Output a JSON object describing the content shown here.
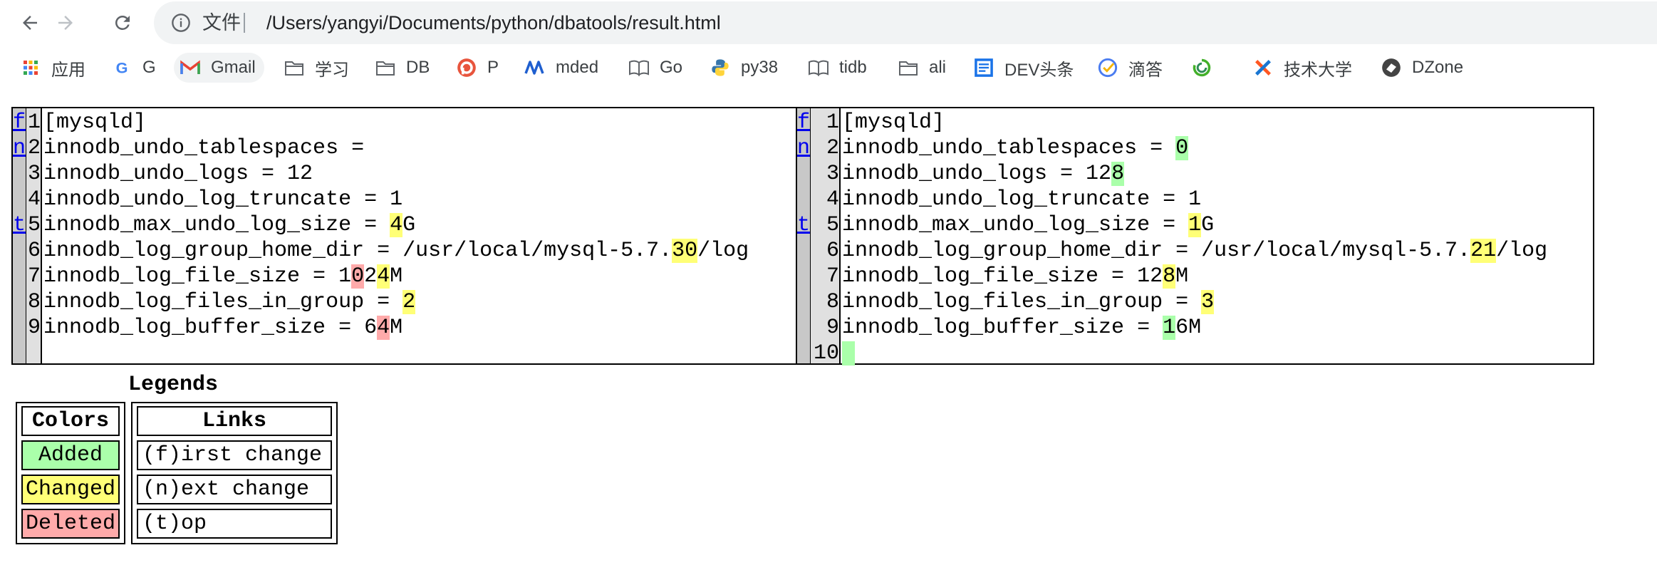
{
  "browser": {
    "info_label": "文件",
    "url": "/Users/yangyi/Documents/python/dbatools/result.html"
  },
  "bookmarks": {
    "apps": "应用",
    "google": "G",
    "gmail": "Gmail",
    "study": "学习",
    "db": "DB",
    "p": "P",
    "mded": "mded",
    "go": "Go",
    "py38": "py38",
    "tidb": "tidb",
    "ali": "ali",
    "dev": "DEV头条",
    "didiao": "滴答",
    "tech": "技术大学",
    "dzone": "DZone"
  },
  "diff": {
    "nav_links": {
      "first": "f",
      "next": "n",
      "top": "t"
    },
    "left": {
      "lines": [
        {
          "num": "1",
          "parts": [
            {
              "t": "[mysqld]",
              "s": ""
            }
          ]
        },
        {
          "num": "2",
          "parts": [
            {
              "t": "innodb_undo_tablespaces = ",
              "s": ""
            }
          ]
        },
        {
          "num": "3",
          "parts": [
            {
              "t": "innodb_undo_logs = 12",
              "s": ""
            }
          ]
        },
        {
          "num": "4",
          "parts": [
            {
              "t": "innodb_undo_log_truncate = 1",
              "s": ""
            }
          ]
        },
        {
          "num": "5",
          "parts": [
            {
              "t": "innodb_max_undo_log_size = ",
              "s": ""
            },
            {
              "t": "4",
              "s": "chg"
            },
            {
              "t": "G",
              "s": ""
            }
          ]
        },
        {
          "num": "6",
          "parts": [
            {
              "t": "innodb_log_group_home_dir = /usr/local/mysql-5.7.",
              "s": ""
            },
            {
              "t": "30",
              "s": "chg"
            },
            {
              "t": "/log",
              "s": ""
            }
          ]
        },
        {
          "num": "7",
          "parts": [
            {
              "t": "innodb_log_file_size = 1",
              "s": ""
            },
            {
              "t": "0",
              "s": "del"
            },
            {
              "t": "2",
              "s": ""
            },
            {
              "t": "4",
              "s": "chg"
            },
            {
              "t": "M",
              "s": ""
            }
          ]
        },
        {
          "num": "8",
          "parts": [
            {
              "t": "innodb_log_files_in_group = ",
              "s": ""
            },
            {
              "t": "2",
              "s": "chg"
            }
          ]
        },
        {
          "num": "9",
          "parts": [
            {
              "t": "innodb_log_buffer_size = 6",
              "s": ""
            },
            {
              "t": "4",
              "s": "del"
            },
            {
              "t": "M",
              "s": ""
            }
          ]
        }
      ]
    },
    "right": {
      "lines": [
        {
          "num": "1",
          "parts": [
            {
              "t": "[mysqld]",
              "s": ""
            }
          ]
        },
        {
          "num": "2",
          "parts": [
            {
              "t": "innodb_undo_tablespaces = ",
              "s": ""
            },
            {
              "t": "0",
              "s": "add"
            }
          ]
        },
        {
          "num": "3",
          "parts": [
            {
              "t": "innodb_undo_logs = 12",
              "s": ""
            },
            {
              "t": "8",
              "s": "add"
            }
          ]
        },
        {
          "num": "4",
          "parts": [
            {
              "t": "innodb_undo_log_truncate = 1",
              "s": ""
            }
          ]
        },
        {
          "num": "5",
          "parts": [
            {
              "t": "innodb_max_undo_log_size = ",
              "s": ""
            },
            {
              "t": "1",
              "s": "chg"
            },
            {
              "t": "G",
              "s": ""
            }
          ]
        },
        {
          "num": "6",
          "parts": [
            {
              "t": "innodb_log_group_home_dir = /usr/local/mysql-5.7.",
              "s": ""
            },
            {
              "t": "21",
              "s": "chg"
            },
            {
              "t": "/log",
              "s": ""
            }
          ]
        },
        {
          "num": "7",
          "parts": [
            {
              "t": "innodb_log_file_size = 12",
              "s": ""
            },
            {
              "t": "8",
              "s": "chg"
            },
            {
              "t": "M",
              "s": ""
            }
          ]
        },
        {
          "num": "8",
          "parts": [
            {
              "t": "innodb_log_files_in_group = ",
              "s": ""
            },
            {
              "t": "3",
              "s": "chg"
            }
          ]
        },
        {
          "num": "9",
          "parts": [
            {
              "t": "innodb_log_buffer_size = ",
              "s": ""
            },
            {
              "t": "1",
              "s": "add"
            },
            {
              "t": "6M",
              "s": ""
            }
          ]
        },
        {
          "num": "10",
          "parts": [
            {
              "t": " ",
              "s": "add"
            }
          ]
        }
      ]
    }
  },
  "legends": {
    "title": "Legends",
    "colors_header": "Colors",
    "added": "Added",
    "changed": "Changed",
    "deleted": "Deleted",
    "links_header": "Links",
    "first_change": "(f)irst change",
    "next_change": "(n)ext change",
    "top": "(t)op"
  },
  "colors": {
    "added": "#aaffaa",
    "changed": "#ffff77",
    "deleted": "#ffaaaa"
  }
}
